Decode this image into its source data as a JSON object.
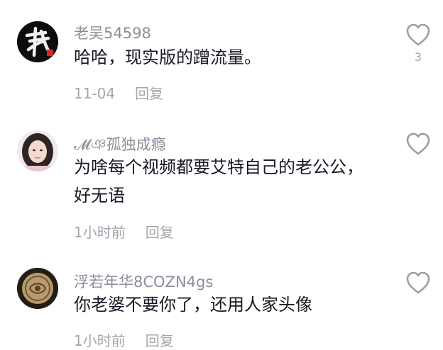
{
  "comments": [
    {
      "username": "老吴54598",
      "text": "哈哈，现实版的蹭流量。",
      "time": "11-04",
      "reply": "回复",
      "likes": "3",
      "avatar_icon": "calligraphy-logo-icon"
    },
    {
      "username": "𝓜ঞ孤独成瘾",
      "text": "为啥每个视频都要艾特自己的老公公，好无语",
      "time": "1小时前",
      "reply": "回复",
      "likes": "",
      "avatar_icon": "girl-photo-avatar"
    },
    {
      "username": "浮若年华8COZN4gs",
      "text": "你老婆不要你了，还用人家头像",
      "time": "1小时前",
      "reply": "回复",
      "likes": "",
      "avatar_icon": "bronze-coin-avatar"
    }
  ],
  "colors": {
    "username": "#8a8f99",
    "text": "#161823",
    "meta": "#a3a6ad",
    "heart_outline": "#9b9ea4"
  }
}
